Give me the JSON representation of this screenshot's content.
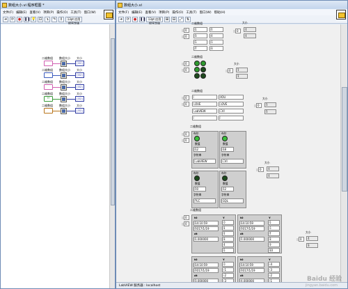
{
  "left_window": {
    "title": "数组大小.vi 程序框图 *",
    "menu": [
      "文件(F)",
      "编辑(E)",
      "查看(V)",
      "项目(P)",
      "操作(O)",
      "工具(T)",
      "窗口(W)"
    ],
    "toolbar_font": "13pt 应用程序字体",
    "nodes": [
      {
        "label": "二维数组",
        "fn_label": "数组大小",
        "ind_label": "大小",
        "ind_value": "[I32]",
        "color": "#d15fb1",
        "const_text": ""
      },
      {
        "label": "二维数组",
        "fn_label": "数组大小",
        "ind_label": "大小",
        "ind_value": "[I32]",
        "color": "#3b5bbd",
        "const_text": ""
      },
      {
        "label": "二维数组",
        "fn_label": "数组大小",
        "ind_label": "大小",
        "ind_value": "[I32]",
        "color": "#d15fb1",
        "const_text": ""
      },
      {
        "label": "二维数组",
        "fn_label": "数组大小",
        "ind_label": "大小",
        "ind_value": "[I32]",
        "color": "#3a9a3a",
        "const_text": "TF"
      },
      {
        "label": "二维数组",
        "fn_label": "数组大小",
        "ind_label": "大小",
        "ind_value": "[I32]",
        "color": "#b8741a",
        "const_text": ""
      }
    ]
  },
  "right_window": {
    "title": "数组大小.vi",
    "menu": [
      "文件(F)",
      "编辑(E)",
      "查看(V)",
      "项目(P)",
      "操作(O)",
      "工具(T)",
      "窗口(W)",
      "帮助(H)"
    ],
    "toolbar_font": "13pt 应用程序字体",
    "status_text": "LabVIEW  服务器 : localhost",
    "watermark": "Baidu 经验",
    "watermark_sub": "jingyan.baidu.com",
    "numeric": {
      "label": "二维数组",
      "idx": [
        "0",
        "0"
      ],
      "cells": [
        "1",
        "2",
        "3",
        "4",
        "5",
        "6",
        "7",
        "8"
      ],
      "size_label": "大小",
      "size_idx": "0",
      "size": [
        "4",
        "4"
      ]
    },
    "boolean": {
      "label": "二维数组",
      "idx": [
        "0",
        "0"
      ],
      "size_label": "大小",
      "size_idx": "0",
      "size": [
        "2",
        "2"
      ]
    },
    "string": {
      "label": "二维数组",
      "idx": [
        "0",
        "0"
      ],
      "cells": [
        "I",
        "YOU",
        "LOVE",
        "LOVE",
        "LabVIEW",
        "CVI",
        "!",
        "!"
      ],
      "size_label": "大小",
      "size_idx": "0",
      "size": [
        "2",
        "2"
      ]
    },
    "cluster": {
      "label": "二维数组",
      "idx": [
        "0",
        "0"
      ],
      "items": [
        {
          "bool_label": "布尔",
          "num_label": "数值",
          "num": "12",
          "str_label": "字符串",
          "str": "LabVIEW"
        },
        {
          "bool_label": "布尔",
          "num_label": "数值",
          "num": "18",
          "str_label": "字符串",
          "str": "CVI"
        },
        {
          "bool_label": "布尔",
          "num_label": "数值",
          "num": "20",
          "str_label": "字符串",
          "str": "PLC"
        },
        {
          "bool_label": "布尔",
          "num_label": "数值",
          "num": "22",
          "str_label": "字符串",
          "str": "SQL"
        }
      ],
      "size_label": "大小",
      "size_idx": "0",
      "size": [
        "4",
        "4"
      ]
    },
    "waveform": {
      "label": "二维数组",
      "idx": [
        "0",
        "0"
      ],
      "items": [
        {
          "t0_label": "t0",
          "time": "14:10:59",
          "date": "2017/1/19",
          "dt_label": "dt",
          "dt": "1.000000",
          "y_label": "Y",
          "y": [
            "0",
            "1",
            "2",
            "3",
            "4",
            "5"
          ]
        },
        {
          "t0_label": "t0",
          "time": "14:10:59",
          "date": "2017/1/19",
          "dt_label": "dt",
          "dt": "2.000000",
          "y_label": "Y",
          "y": [
            "5",
            "6",
            "7",
            "8",
            "9",
            "10"
          ]
        },
        {
          "t0_label": "t0",
          "time": "14:10:59",
          "date": "2017/1/19",
          "dt_label": "dt",
          "dt": "3.000000",
          "y_label": "Y",
          "y": [
            "0",
            "-1",
            "-2",
            "-3",
            "-4"
          ]
        },
        {
          "t0_label": "t0",
          "time": "14:10:59",
          "date": "2017/1/19",
          "dt_label": "dt",
          "dt": "4.000000",
          "y_label": "Y",
          "y": [
            "-4",
            "-3",
            "-2",
            "-1"
          ]
        }
      ],
      "size_label": "大小",
      "size_idx": "0",
      "size": [
        "4",
        "3"
      ]
    }
  }
}
